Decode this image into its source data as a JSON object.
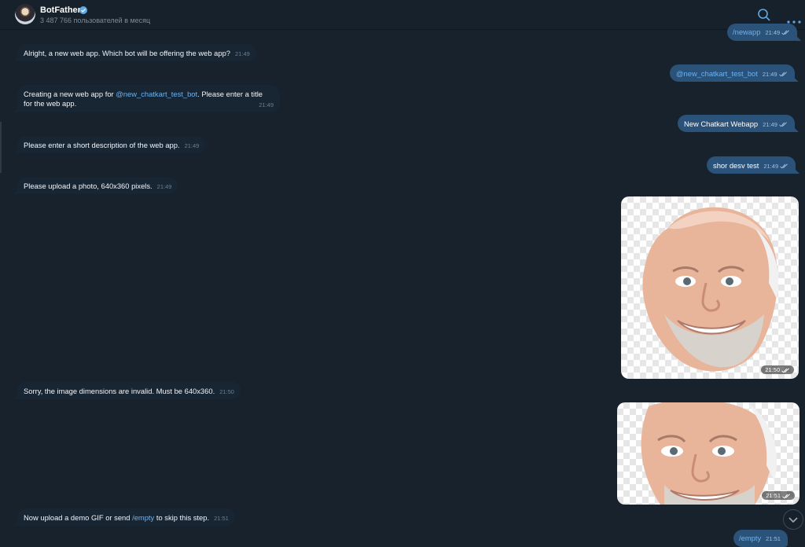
{
  "header": {
    "bot_name": "BotFather",
    "subscribers": "3 487 766 пользователей в месяц"
  },
  "colors": {
    "background": "#18222d",
    "incoming": "#182533",
    "outgoing": "#2b5278",
    "link": "#6ab3f3",
    "verified": "#5fa9e6"
  },
  "icons": [
    "search-icon",
    "more-icon",
    "verified-icon",
    "read-ticks-icon",
    "chevron-down-icon"
  ],
  "messages": {
    "m1": {
      "text": "/newapp",
      "time": "21:49"
    },
    "m2": {
      "text": "Alright, a new web app. Which bot will be offering the web app?",
      "time": "21:49"
    },
    "m3": {
      "text": "@new_chatkart_test_bot",
      "time": "21:49"
    },
    "m4": {
      "pre": "Creating a new web app for ",
      "link": "@new_chatkart_test_bot",
      "post": ". Please enter a title",
      "line2": "for the web app.",
      "time": "21:49"
    },
    "m5": {
      "text": "New Chatkart Webapp",
      "time": "21:49"
    },
    "m6": {
      "text": "Please enter a short description of the web app.",
      "time": "21:49"
    },
    "m7": {
      "text": "shor desv test",
      "time": "21:49"
    },
    "m8": {
      "text": "Please upload a photo, 640x360 pixels.",
      "time": "21:49"
    },
    "p1": {
      "time": "21:50"
    },
    "m9": {
      "text": "Sorry, the image dimensions are invalid. Must be 640x360.",
      "time": "21:50"
    },
    "p2": {
      "time": "21:51"
    },
    "m10": {
      "pre": "Now upload a demo GIF or send ",
      "link": "/empty",
      "post": " to skip this step.",
      "time": "21:51"
    },
    "m11": {
      "text": "/empty",
      "time": "21:51"
    }
  }
}
